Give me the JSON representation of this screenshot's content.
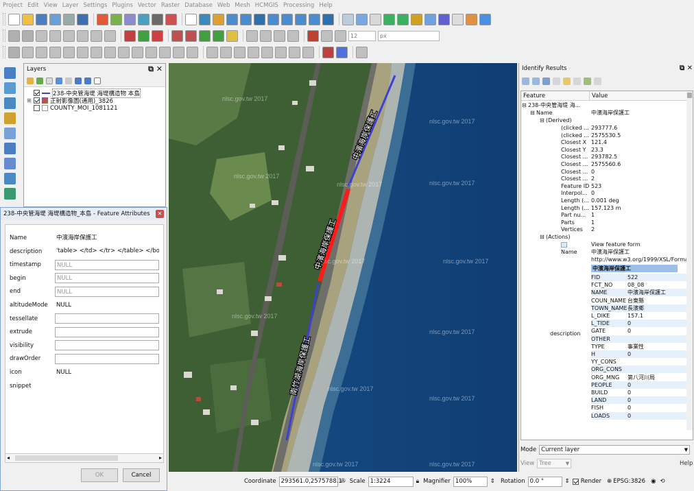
{
  "menubar": [
    "Project",
    "Edit",
    "View",
    "Layer",
    "Settings",
    "Plugins",
    "Vector",
    "Raster",
    "Database",
    "Web",
    "Mesh",
    "HCMGIS",
    "Processing",
    "Help"
  ],
  "toolbar": {
    "label_size": "12",
    "label_unit": "px"
  },
  "layers_panel": {
    "title": "Layers",
    "layers": [
      {
        "name": "238-中央管海堤 海堤構造物 本島",
        "checked": true,
        "expanded": false,
        "selected": true
      },
      {
        "name": "正射影像圖(通用)_3826",
        "checked": true,
        "expanded": true,
        "selected": false
      },
      {
        "name": "COUNTY_MOI_1081121",
        "checked": false,
        "expanded": false,
        "selected": false
      }
    ]
  },
  "feature_dialog": {
    "title": "238-中央管海堤 海堤構造物_本島 - Feature Attributes",
    "fields": [
      {
        "label": "Name",
        "value": "中濱海岸保護工",
        "style": "plain"
      },
      {
        "label": "description",
        "value": "'table> </td> </tr> </table> </bo(",
        "style": "plain"
      },
      {
        "label": "timestamp",
        "value": "NULL",
        "style": "box-null"
      },
      {
        "label": "begin",
        "value": "NULL",
        "style": "box-null"
      },
      {
        "label": "end",
        "value": "NULL",
        "style": "box-null"
      },
      {
        "label": "altitudeMode",
        "value": "NULL",
        "style": "plain"
      },
      {
        "label": "tessellate",
        "value": "",
        "style": "box"
      },
      {
        "label": "extrude",
        "value": "",
        "style": "box"
      },
      {
        "label": "visibility",
        "value": "",
        "style": "box"
      },
      {
        "label": "drawOrder",
        "value": "",
        "style": "box"
      },
      {
        "label": "icon",
        "value": "NULL",
        "style": "plain"
      },
      {
        "label": "snippet",
        "value": "",
        "style": "plain"
      }
    ],
    "ok_label": "OK",
    "cancel_label": "Cancel"
  },
  "map": {
    "watermark": "nlsc.gov.tw 2017",
    "labels": [
      "中濱海岸保護工",
      "中濱海岸保護工",
      "南竹湖海岸保護工"
    ]
  },
  "identify": {
    "title": "Identify Results",
    "col_feature": "Feature",
    "col_value": "Value",
    "root": "238-中央管海堤 海...",
    "name_key": "Name",
    "name_value": "中濱海岸保護工",
    "derived_label": "(Derived)",
    "derived": [
      {
        "k": "(clicked ...",
        "v": "293777.6"
      },
      {
        "k": "(clicked ...",
        "v": "2575530.5"
      },
      {
        "k": "Closest X",
        "v": "121.4"
      },
      {
        "k": "Closest Y",
        "v": "23.3"
      },
      {
        "k": "Closest ...",
        "v": "293782.5"
      },
      {
        "k": "Closest ...",
        "v": "2575560.6"
      },
      {
        "k": "Closest ...",
        "v": "0"
      },
      {
        "k": "Closest ...",
        "v": "2"
      },
      {
        "k": "Feature ID",
        "v": "523"
      },
      {
        "k": "Interpol...",
        "v": "0"
      },
      {
        "k": "Length (...",
        "v": "0.001 deg"
      },
      {
        "k": "Length (...",
        "v": "157.123 m"
      },
      {
        "k": "Part nu...",
        "v": "1"
      },
      {
        "k": "Parts",
        "v": "1"
      },
      {
        "k": "Vertices",
        "v": "2"
      }
    ],
    "actions_label": "(Actions)",
    "view_form": "View feature form",
    "name2_key": "Name",
    "name2_value": "中濱海岸保護工",
    "xsl_url": "http://www.w3.org/1999/XSL/Forma",
    "desc_header": "中濱海岸保護工",
    "desc_key": "description",
    "desc_rows": [
      {
        "k": "FID",
        "v": "522"
      },
      {
        "k": "FCT_NO",
        "v": "08_08"
      },
      {
        "k": "NAME",
        "v": "中濱海岸保護工"
      },
      {
        "k": "COUN_NAME",
        "v": "台東縣"
      },
      {
        "k": "TOWN_NAME",
        "v": "長濱鄉"
      },
      {
        "k": "L_DIKE",
        "v": "157.1"
      },
      {
        "k": "L_TIDE",
        "v": "0"
      },
      {
        "k": "GATE",
        "v": "0"
      },
      {
        "k": "OTHER",
        "v": ""
      },
      {
        "k": "TYPE",
        "v": "事業性"
      },
      {
        "k": "H",
        "v": "0"
      },
      {
        "k": "YY_CONS",
        "v": ""
      },
      {
        "k": "ORG_CONS",
        "v": ""
      },
      {
        "k": "ORG_MNG",
        "v": "第八河川局"
      },
      {
        "k": "PEOPLE",
        "v": "0"
      },
      {
        "k": "BUILD",
        "v": "0"
      },
      {
        "k": "LAND",
        "v": "0"
      },
      {
        "k": "FISH",
        "v": "0"
      },
      {
        "k": "LOADS",
        "v": "0"
      }
    ],
    "mode_label": "Mode",
    "mode_value": "Current layer",
    "view_label": "View",
    "view_value": "Tree",
    "help_label": "Help"
  },
  "status": {
    "coordinate_label": "Coordinate",
    "coordinate_value": "293561.0,2575788.1",
    "scale_label": "Scale",
    "scale_value": "1:3224",
    "magnifier_label": "Magnifier",
    "magnifier_value": "100%",
    "rotation_label": "Rotation",
    "rotation_value": "0.0 °",
    "render_label": "Render",
    "crs_label": "EPSG:3826"
  }
}
